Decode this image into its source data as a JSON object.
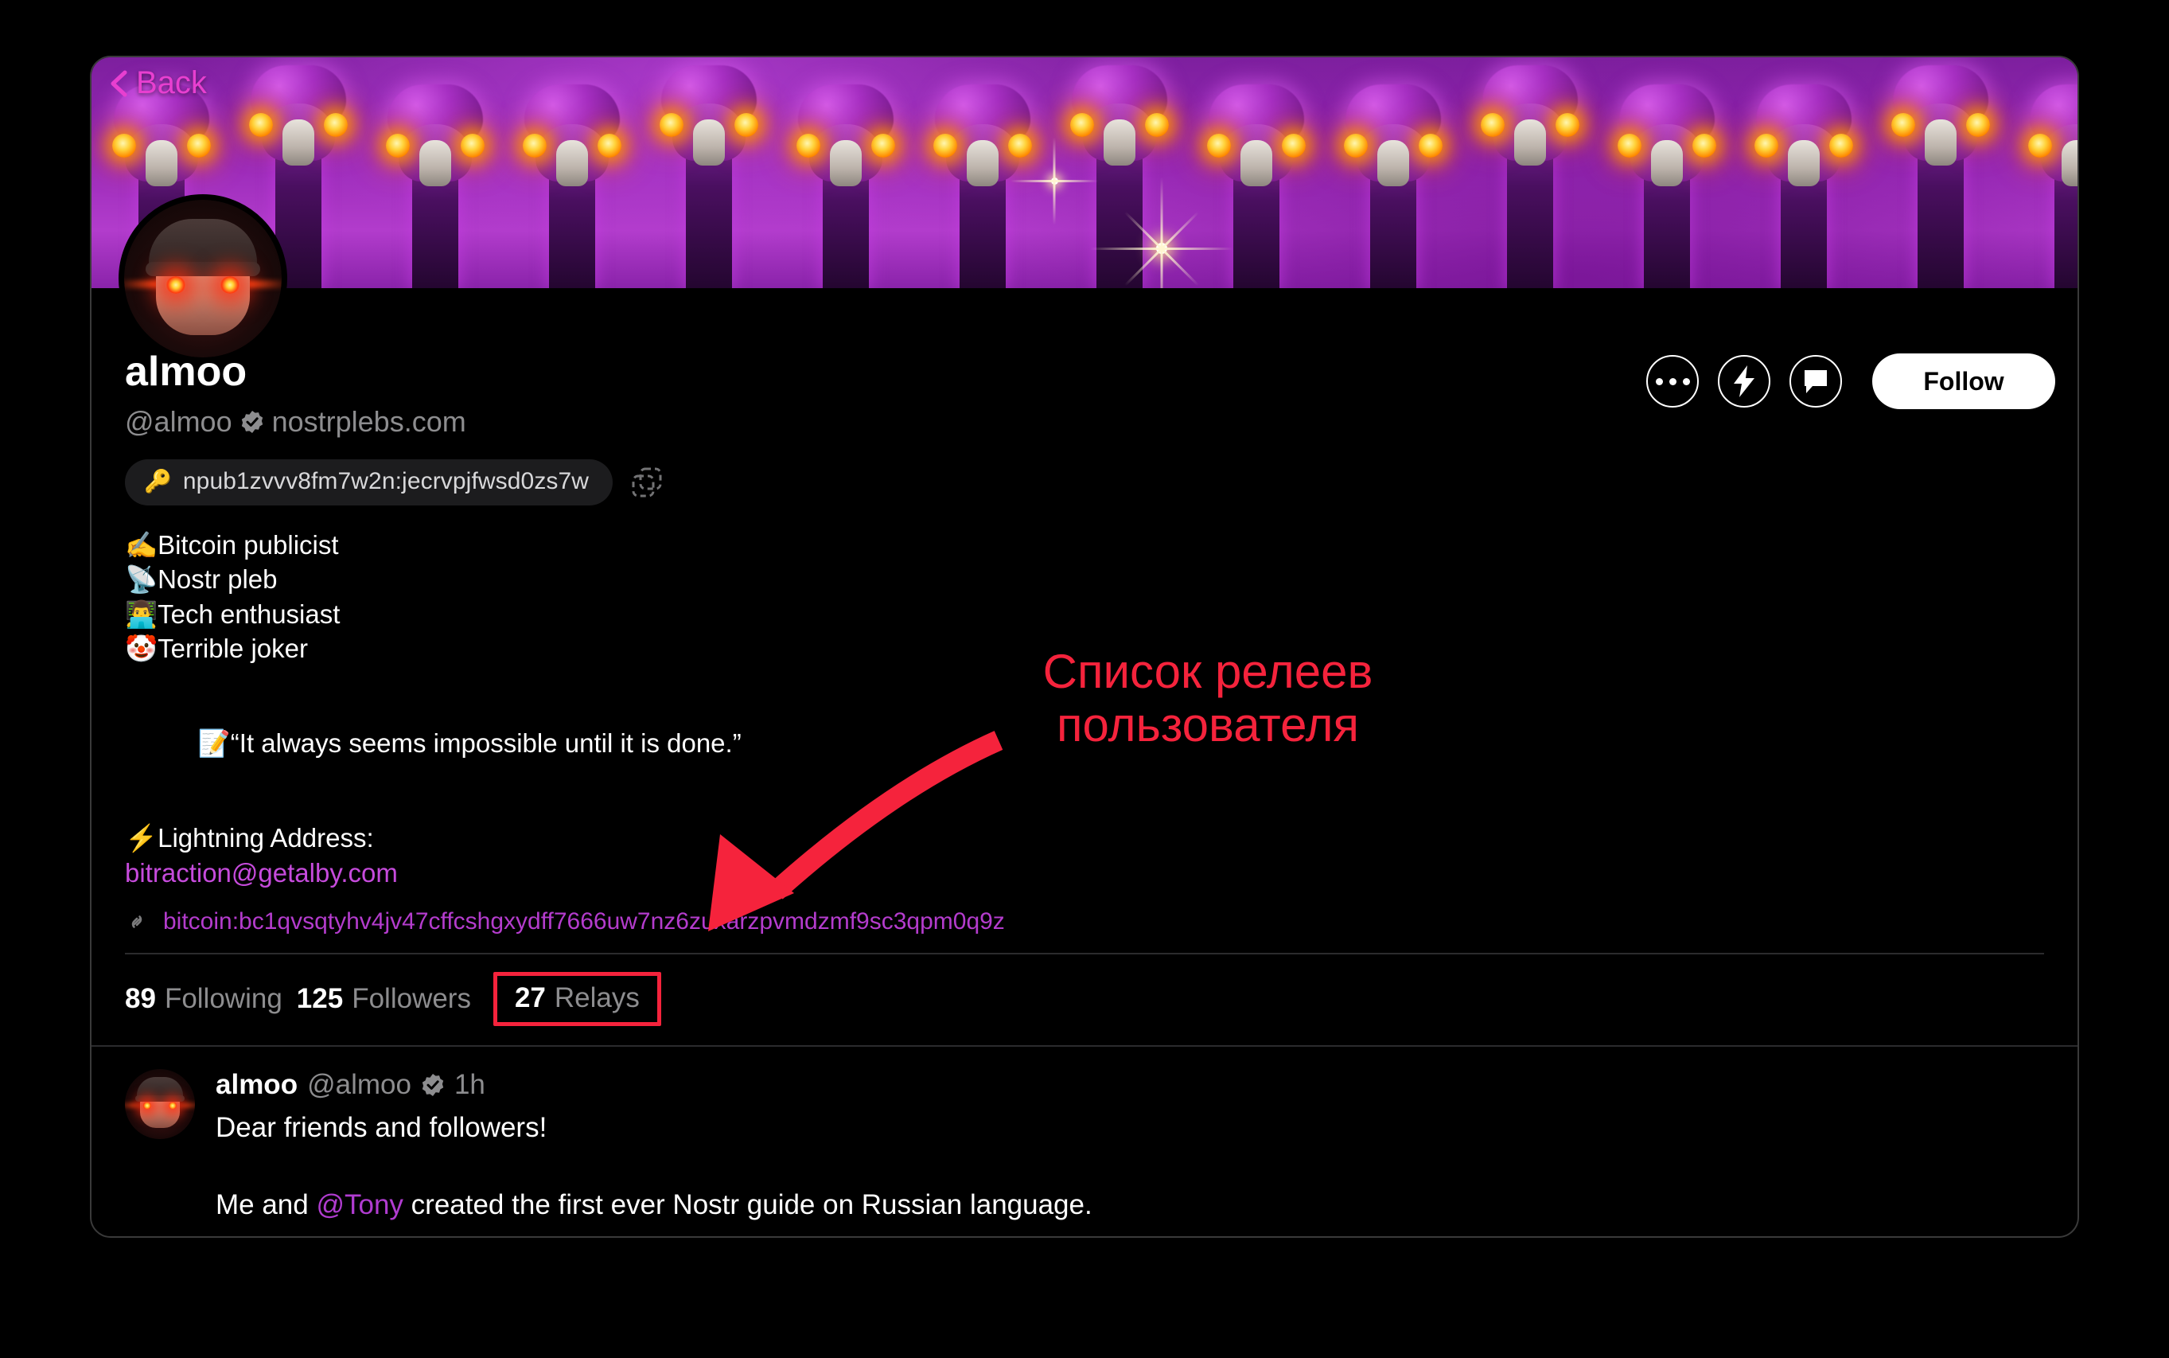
{
  "app": {
    "background_color": "#000000",
    "accent_magenta": "#c64bdc",
    "annotation_color": "#f5233c"
  },
  "banner": {
    "name": "profile-banner-image",
    "description": "purple ostriches with glowing laser eyes",
    "back_label": "Back",
    "back_icon": "chevron-left-icon"
  },
  "avatar": {
    "name": "profile-avatar",
    "description": "face with red laser eyes wearing a beanie"
  },
  "actions": {
    "more_icon": "ellipsis-icon",
    "zap_icon": "lightning-bolt-icon",
    "message_icon": "chat-bubble-icon",
    "follow_label": "Follow"
  },
  "profile": {
    "display_name": "almoo",
    "handle": "@almoo",
    "verified_icon": "verified-badge-icon",
    "nip05_domain": "nostrplebs.com",
    "npub": "npub1zvvv8fm7w2n:jecrvpjfwsd0zs7w",
    "npub_key_icon": "key-icon",
    "copy_icon": "copy-icon",
    "bio_lines": [
      "✍️Bitcoin publicist",
      "📡Nostr pleb",
      "👨‍💻Tech enthusiast",
      "🤡Terrible joker"
    ],
    "quote_line": "📝It always seems impossible until it is done.”",
    "quote_emoji": "📝",
    "quote_text": "“It always seems impossible until it is done.”",
    "lightning_label": "⚡Lightning Address:",
    "lightning_address": "bitraction@getalby.com",
    "bitcoin_link_icon": "link-icon",
    "bitcoin_uri": "bitcoin:bc1qvsqtyhv4jv47cffcshgxydff7666uw7nz6zuxarzpvmdzmf9sc3qpm0q9z"
  },
  "stats": [
    {
      "value": "89",
      "label": "Following",
      "highlighted": false
    },
    {
      "value": "125",
      "label": "Followers",
      "highlighted": false
    },
    {
      "value": "27",
      "label": "Relays",
      "highlighted": true
    }
  ],
  "note": {
    "author_name": "almoo",
    "author_handle": "@almoo",
    "verified_icon": "verified-badge-icon",
    "timestamp": "1h",
    "paragraph_1": "Dear friends and followers!",
    "paragraph_2_pre": "Me and ",
    "paragraph_2_mention": "@Tony",
    "paragraph_2_post": " created the first ever Nostr guide on Russian language."
  },
  "annotation": {
    "text_line_1": "Список релеев",
    "text_line_2": "пользователя",
    "arrow_icon": "curved-arrow-icon",
    "box_target": "27 Relays"
  }
}
